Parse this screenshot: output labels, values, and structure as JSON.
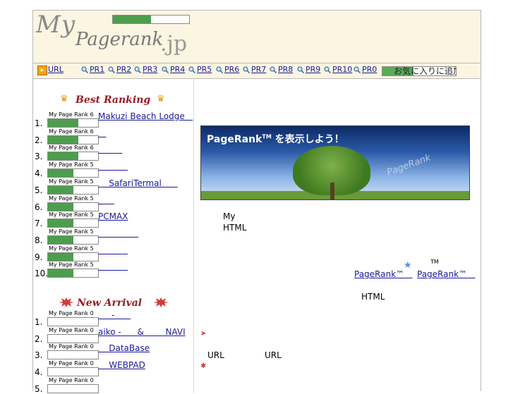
{
  "header": {
    "logo_my": "My",
    "logo_pagerank": "Pagerank",
    "logo_jp": ".jp",
    "logo_bar_level": 0.5
  },
  "nav": {
    "url_label": "URL",
    "links": [
      "PR1",
      "PR2",
      "PR3",
      "PR4",
      "PR5",
      "PR6",
      "PR7",
      "PR8",
      "PR9",
      "PR10",
      "PR0"
    ],
    "favorite_label": "お気に入りに追加"
  },
  "best_ranking": {
    "title": "Best Ranking",
    "items": [
      {
        "num": "1.",
        "pr_label": "My Page Rank 6",
        "level": 0.6,
        "name": "Makuzi Beach Lodge   "
      },
      {
        "num": "2.",
        "pr_label": "My Page Rank 6",
        "level": 0.6,
        "name": "   "
      },
      {
        "num": "3.",
        "pr_label": "My Page Rank 6",
        "level": 0.6,
        "name": "         "
      },
      {
        "num": "4.",
        "pr_label": "My Page Rank 5",
        "level": 0.5,
        "name": "           "
      },
      {
        "num": "5.",
        "pr_label": "My Page Rank 5",
        "level": 0.5,
        "name": "    SafariTermal      "
      },
      {
        "num": "6.",
        "pr_label": "My Page Rank 5",
        "level": 0.5,
        "name": "      "
      },
      {
        "num": "7.",
        "pr_label": "My Page Rank 5",
        "level": 0.5,
        "name": "PCMAX"
      },
      {
        "num": "8.",
        "pr_label": "My Page Rank 5",
        "level": 0.5,
        "name": "               "
      },
      {
        "num": "9.",
        "pr_label": "My Page Rank 5",
        "level": 0.5,
        "name": "           "
      },
      {
        "num": "10.",
        "pr_label": "My Page Rank 5",
        "level": 0.5,
        "name": "           "
      }
    ]
  },
  "new_arrival": {
    "title": "New Arrival",
    "items": [
      {
        "num": "1.",
        "pr_label": "My Page Rank 0",
        "level": 0,
        "name": "     -      "
      },
      {
        "num": "2.",
        "pr_label": "My Page Rank 0",
        "level": 0,
        "name": "aiko -      &        NAVI"
      },
      {
        "num": "3.",
        "pr_label": "My Page Rank 0",
        "level": 0,
        "name": "    DataBase"
      },
      {
        "num": "4.",
        "pr_label": "My Page Rank 0",
        "level": 0,
        "name": "    WEBPAD"
      },
      {
        "num": "5.",
        "pr_label": "My Page Rank 0",
        "level": 0,
        "name": ""
      }
    ]
  },
  "main": {
    "banner_text": "PageRank",
    "banner_tm": "TM",
    "banner_suffix": " を表示しよう！",
    "banner_watermark": "PageRank",
    "line_my": "My",
    "line_html": "HTML",
    "tm_label": "TM",
    "pr_link_1": "PageRank™   ",
    "pr_link_2": "PageRank™   ",
    "html_label": "HTML",
    "url_label_1": "URL",
    "url_label_2": "URL"
  },
  "colors": {
    "accent_green": "#4e9d4e",
    "link": "#1a1a9a",
    "header_bg": "#fbf5e1",
    "title_red": "#9a1c24"
  }
}
